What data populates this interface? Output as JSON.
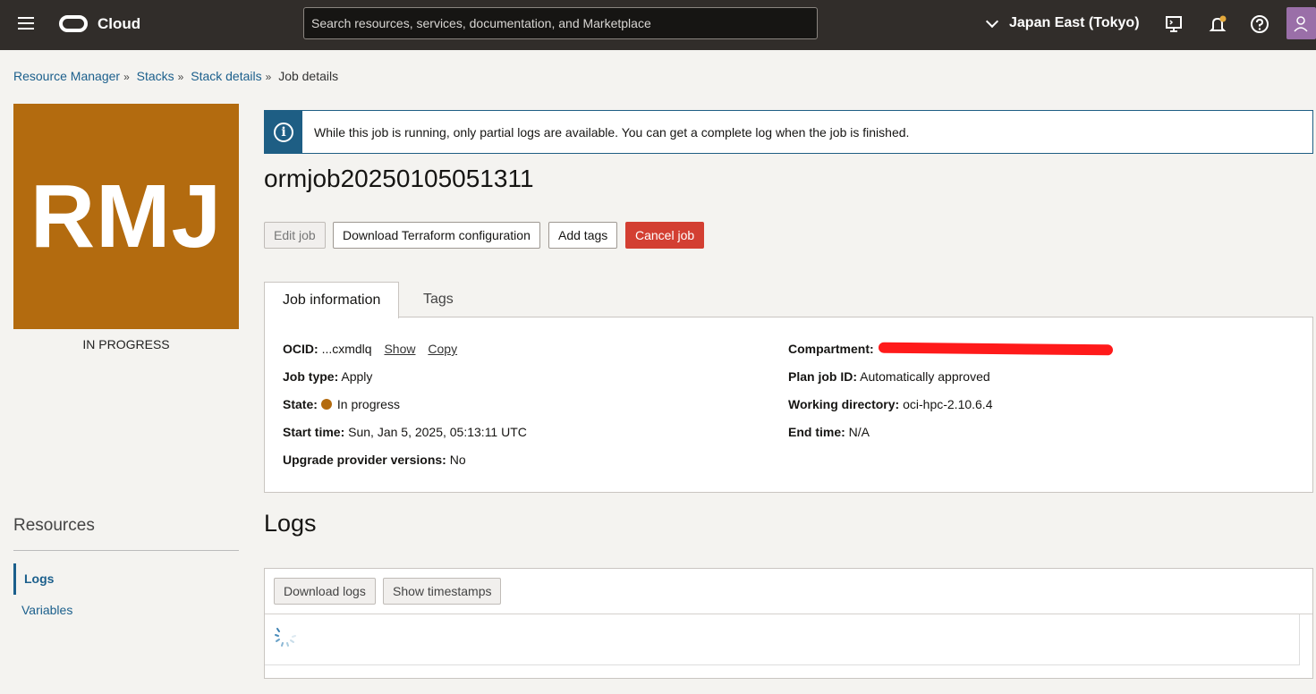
{
  "header": {
    "brand": "Cloud",
    "search_placeholder": "Search resources, services, documentation, and Marketplace",
    "region": "Japan East (Tokyo)"
  },
  "breadcrumb": {
    "items": [
      "Resource Manager",
      "Stacks",
      "Stack details"
    ],
    "current": "Job details"
  },
  "tile": {
    "initials": "RMJ",
    "status": "IN PROGRESS",
    "color": "#b36b0f"
  },
  "resources": {
    "title": "Resources",
    "items": [
      "Logs",
      "Variables"
    ]
  },
  "banner": {
    "message": "While this job is running, only partial logs are available. You can get a complete log when the job is finished."
  },
  "job": {
    "title": "ormjob20250105051311"
  },
  "actions": {
    "edit": "Edit job",
    "download": "Download Terraform configuration",
    "tags": "Add tags",
    "cancel": "Cancel job"
  },
  "tabs": {
    "info": "Job information",
    "tags": "Tags"
  },
  "info": {
    "ocid_label": "OCID:",
    "ocid_value": "...cxmdlq",
    "show": "Show",
    "copy": "Copy",
    "job_type_label": "Job type:",
    "job_type_value": "Apply",
    "state_label": "State:",
    "state_value": "In progress",
    "start_label": "Start time:",
    "start_value": "Sun, Jan 5, 2025, 05:13:11 UTC",
    "upgrade_label": "Upgrade provider versions:",
    "upgrade_value": "No",
    "compartment_label": "Compartment:",
    "plan_label": "Plan job ID:",
    "plan_value": "Automatically approved",
    "workdir_label": "Working directory:",
    "workdir_value": "oci-hpc-2.10.6.4",
    "end_label": "End time:",
    "end_value": "N/A"
  },
  "logs": {
    "title": "Logs",
    "download": "Download logs",
    "timestamps": "Show timestamps"
  },
  "colors": {
    "header_bg": "#312d2a",
    "link": "#1b5f8c",
    "danger": "#d33f32",
    "info_accent": "#1e5e84"
  }
}
